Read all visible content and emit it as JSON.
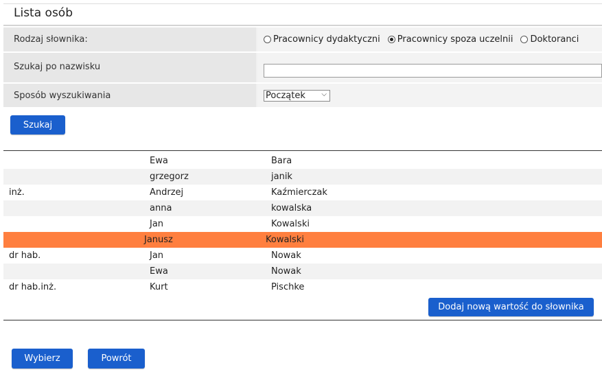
{
  "page": {
    "title": "Lista osób"
  },
  "form": {
    "dictionary_type": {
      "label": "Rodzaj słownika:",
      "options": [
        {
          "label": "Pracownicy dydaktyczni",
          "selected": false
        },
        {
          "label": "Pracownicy spoza uczelnii",
          "selected": true
        },
        {
          "label": "Doktoranci",
          "selected": false
        }
      ]
    },
    "surname_search": {
      "label": "Szukaj po nazwisku",
      "value": "",
      "placeholder": ""
    },
    "search_mode": {
      "label": "Sposób wyszukiwania",
      "selected": "Początek"
    },
    "search_button": "Szukaj"
  },
  "people": [
    {
      "title": "",
      "first_name": "Ewa",
      "last_name": "Bara",
      "selected": false
    },
    {
      "title": "",
      "first_name": "grzegorz",
      "last_name": "janik",
      "selected": false
    },
    {
      "title": "inż.",
      "first_name": "Andrzej",
      "last_name": "Kaźmierczak",
      "selected": false
    },
    {
      "title": "",
      "first_name": "anna",
      "last_name": "kowalska",
      "selected": false
    },
    {
      "title": "",
      "first_name": "Jan",
      "last_name": "Kowalski",
      "selected": false
    },
    {
      "title": "",
      "first_name": "Janusz",
      "last_name": "Kowalski",
      "selected": true
    },
    {
      "title": "dr hab.",
      "first_name": "Jan",
      "last_name": "Nowak",
      "selected": false
    },
    {
      "title": "",
      "first_name": "Ewa",
      "last_name": "Nowak",
      "selected": false
    },
    {
      "title": "dr hab.inż.",
      "first_name": "Kurt",
      "last_name": "Pischke",
      "selected": false
    }
  ],
  "buttons": {
    "add_new": "Dodaj nową wartość do słownika",
    "choose": "Wybierz",
    "back": "Powrót"
  },
  "colors": {
    "accent": "#1a5fcd",
    "selected_row": "#ff7f3f"
  }
}
